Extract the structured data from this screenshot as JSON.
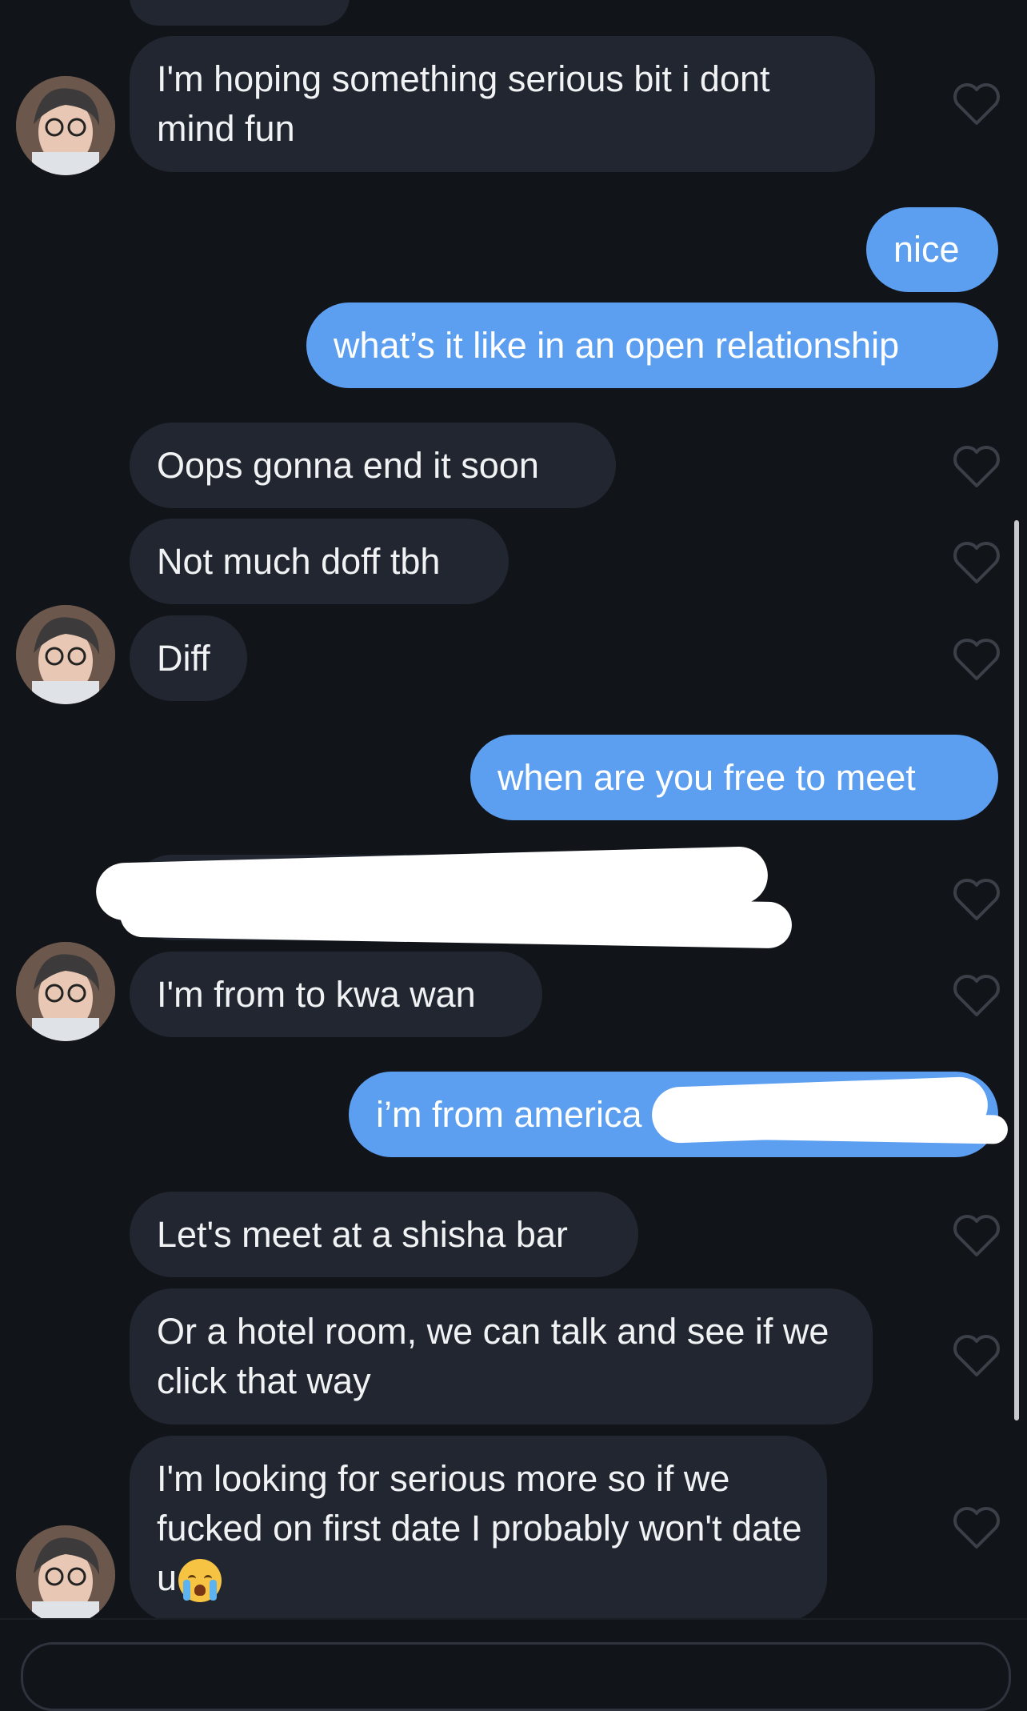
{
  "messages": [
    {
      "from": "them",
      "text": "I'm hoping something serious bit i dont mind fun"
    },
    {
      "from": "me",
      "text": "nice"
    },
    {
      "from": "me",
      "text": "what’s it like in an open relationship"
    },
    {
      "from": "them",
      "text": "Oops gonna end it soon"
    },
    {
      "from": "them",
      "text": "Not much doff tbh"
    },
    {
      "from": "them",
      "text": "Diff"
    },
    {
      "from": "me",
      "text": "when are you free to meet"
    },
    {
      "from": "them",
      "text": "[redacted]"
    },
    {
      "from": "them",
      "text": "I'm from to kwa wan"
    },
    {
      "from": "me",
      "text": "i’m from america"
    },
    {
      "from": "them",
      "text": "Let's meet at a shisha bar"
    },
    {
      "from": "them",
      "text": "Or a hotel room, we can talk and see if we click that way"
    },
    {
      "from": "them",
      "text": "I'm looking for serious more so if we fucked on first date I probably won't date u",
      "emoji": "loudly-crying-face"
    }
  ],
  "icons": {
    "like": "heart-outline-icon",
    "avatar": "contact-avatar"
  },
  "colors": {
    "background": "#111419",
    "incoming_bubble": "#212630",
    "outgoing_bubble": "#5c9ef0",
    "heart": "#3a3f48"
  }
}
